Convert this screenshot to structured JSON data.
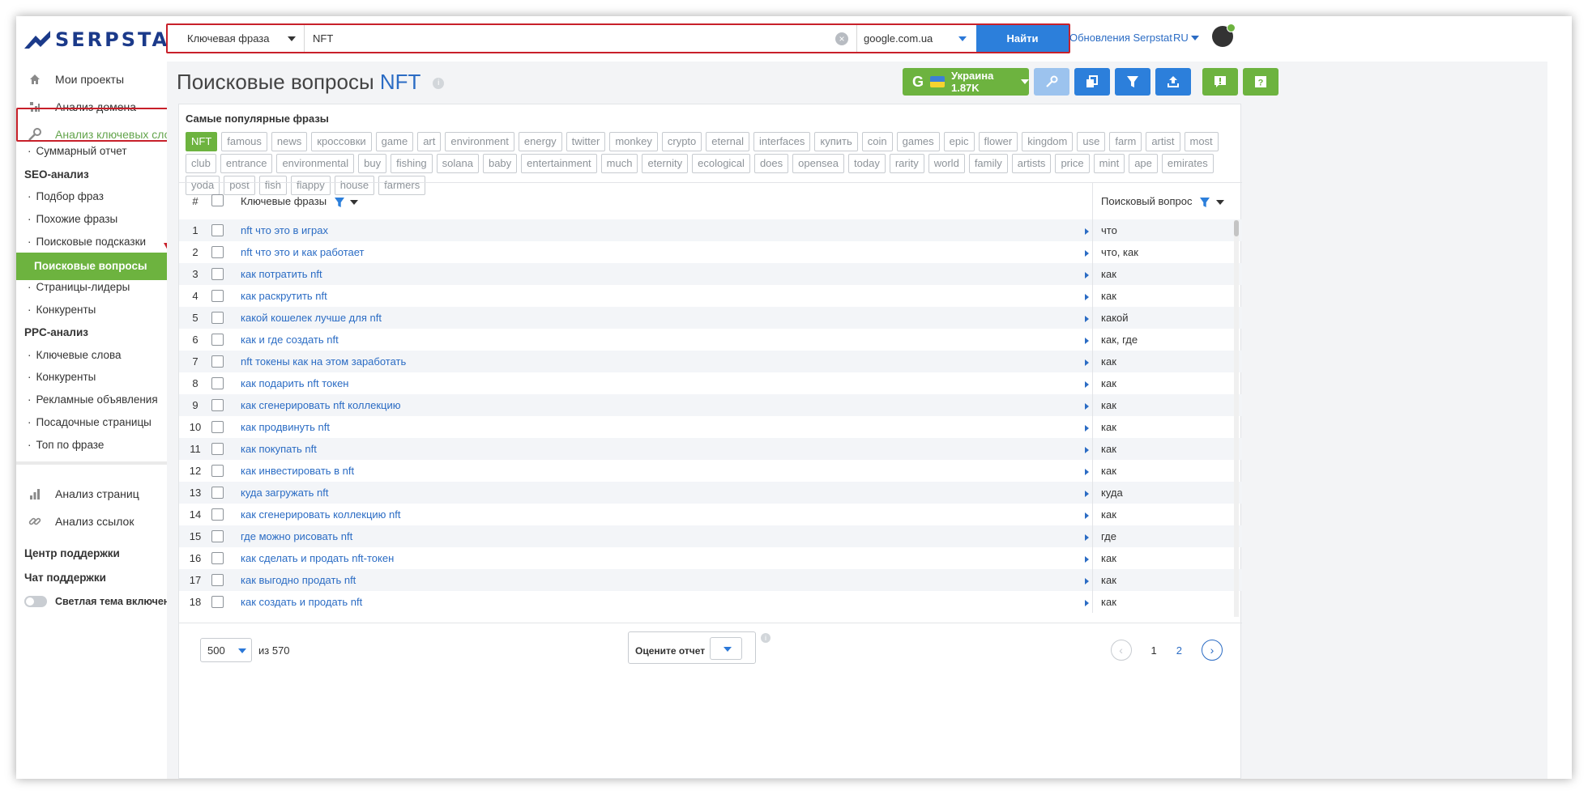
{
  "brand": {
    "logo_text": "SERPSTAT",
    "logo_color": "#1b3a8a"
  },
  "sidebar": {
    "main_items": [
      {
        "label": "Мои проекты",
        "icon": "home-icon"
      },
      {
        "label": "Анализ домена",
        "icon": "domain-analysis-icon"
      },
      {
        "label": "Анализ ключевых слов",
        "icon": "key-icon"
      }
    ],
    "kw_items": [
      "Суммарный отчет"
    ],
    "seo_heading": "SEO-анализ",
    "seo_items": [
      "Подбор фраз",
      "Похожие фразы",
      "Поисковые подсказки",
      "Поисковые вопросы",
      "Страницы-лидеры",
      "Конкуренты"
    ],
    "ppc_heading": "PPC-анализ",
    "ppc_items": [
      "Ключевые слова",
      "Конкуренты",
      "Рекламные объявления",
      "Посадочные страницы",
      "Топ по фразе"
    ],
    "more_items": [
      {
        "label": "Анализ страниц",
        "icon": "page-analysis-icon"
      },
      {
        "label": "Анализ ссылок",
        "icon": "link-icon"
      }
    ],
    "support_center": "Центр поддержки",
    "support_chat": "Чат поддержки",
    "theme_label": "Светлая тема включена"
  },
  "search": {
    "type": "Ключевая фраза",
    "query": "NFT",
    "engine": "google.com.ua",
    "button": "Найти"
  },
  "header": {
    "updates": "Обновления Serpstat",
    "lang": "RU"
  },
  "page": {
    "title": "Поисковые вопросы",
    "keyword": "NFT",
    "region_engine_letter": "G",
    "region": "Украина 1.87K"
  },
  "colors": {
    "accent_green": "#6db33f",
    "accent_blue": "#2c7fdb",
    "link_blue": "#2b6cc4",
    "highlight_red": "#c8202a"
  },
  "popular": {
    "title": "Самые популярные фразы",
    "chips": [
      "NFT",
      "famous",
      "news",
      "кроссовки",
      "game",
      "art",
      "environment",
      "energy",
      "twitter",
      "monkey",
      "crypto",
      "eternal",
      "interfaces",
      "купить",
      "coin",
      "games",
      "epic",
      "flower",
      "kingdom",
      "use",
      "farm",
      "artist",
      "most",
      "club",
      "entrance",
      "environmental",
      "buy",
      "fishing",
      "solana",
      "baby",
      "entertainment",
      "much",
      "eternity",
      "ecological",
      "does",
      "opensea",
      "today",
      "rarity",
      "world",
      "family",
      "artists",
      "price",
      "mint",
      "ape",
      "emirates",
      "yoda",
      "post",
      "fish",
      "flappy",
      "house",
      "farmers"
    ]
  },
  "table": {
    "headers": {
      "num": "#",
      "keywords": "Ключевые фразы",
      "question": "Поисковый вопрос"
    },
    "rows": [
      {
        "n": "1",
        "kw": "nft что это в играх",
        "q": "что"
      },
      {
        "n": "2",
        "kw": "nft что это и как работает",
        "q": "что, как"
      },
      {
        "n": "3",
        "kw": "как потратить nft",
        "q": "как"
      },
      {
        "n": "4",
        "kw": "как раскрутить nft",
        "q": "как"
      },
      {
        "n": "5",
        "kw": "какой кошелек лучше для nft",
        "q": "какой"
      },
      {
        "n": "6",
        "kw": "как и где создать nft",
        "q": "как, где"
      },
      {
        "n": "7",
        "kw": "nft токены как на этом заработать",
        "q": "как"
      },
      {
        "n": "8",
        "kw": "как подарить nft токен",
        "q": "как"
      },
      {
        "n": "9",
        "kw": "как сгенерировать nft коллекцию",
        "q": "как"
      },
      {
        "n": "10",
        "kw": "как продвинуть nft",
        "q": "как"
      },
      {
        "n": "11",
        "kw": "как покупать nft",
        "q": "как"
      },
      {
        "n": "12",
        "kw": "как инвестировать в nft",
        "q": "как"
      },
      {
        "n": "13",
        "kw": "куда загружать nft",
        "q": "куда"
      },
      {
        "n": "14",
        "kw": "как сгенерировать коллекцию nft",
        "q": "как"
      },
      {
        "n": "15",
        "kw": "где можно рисовать nft",
        "q": "где"
      },
      {
        "n": "16",
        "kw": "как сделать и продать nft-токен",
        "q": "как"
      },
      {
        "n": "17",
        "kw": "как выгодно продать nft",
        "q": "как"
      },
      {
        "n": "18",
        "kw": "как создать и продать nft",
        "q": "как"
      }
    ]
  },
  "footer": {
    "per_page": "500",
    "of_total": "из 570",
    "rate_label": "Оцените отчет",
    "pages": [
      "1",
      "2"
    ]
  }
}
